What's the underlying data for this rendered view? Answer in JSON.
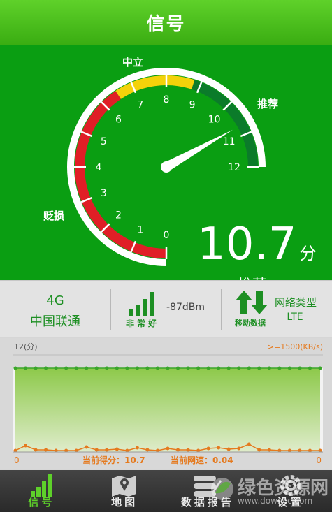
{
  "header": {
    "title": "信号"
  },
  "gauge": {
    "score": "10.7",
    "unit": "分",
    "level": "推荐",
    "zone_labels": {
      "neutral": "中立",
      "recommend": "推荐",
      "poor": "贬损"
    },
    "ticks": [
      "0",
      "1",
      "2",
      "3",
      "4",
      "5",
      "6",
      "7",
      "8",
      "9",
      "10",
      "11",
      "12"
    ],
    "min": 0,
    "max": 12,
    "value": 10.7,
    "colors": {
      "red": "#e01e26",
      "yellow": "#f4d20a",
      "green": "#0b7b2a"
    }
  },
  "network": {
    "generation": "4G",
    "carrier": "中国联通"
  },
  "signal": {
    "quality": "非常好",
    "dbm": "-87dBm",
    "level": 4
  },
  "data_conn": {
    "label": "移动数据"
  },
  "net_type": {
    "label": "网络类型",
    "value": "LTE"
  },
  "chart_data": {
    "type": "line",
    "left_axis_label": "12(分)",
    "right_axis_label": ">=1500(KB/s)",
    "x_left_label": "0",
    "x_right_label": "0",
    "score_text": "当前得分：10.7",
    "speed_text": "当前网速：0.04",
    "series": [
      {
        "name": "当前得分",
        "color": "#3aa62a",
        "values": [
          12,
          12,
          12,
          12,
          12,
          12,
          12,
          12,
          12,
          12,
          12,
          12,
          12,
          12,
          12,
          12,
          12,
          12,
          12,
          12,
          12,
          12,
          12,
          12,
          12,
          12,
          12,
          12,
          12,
          12,
          12
        ]
      },
      {
        "name": "当前网速",
        "color": "#e57a1e",
        "values": [
          0.2,
          0.9,
          0.3,
          0.3,
          0.2,
          0.2,
          0.2,
          0.7,
          0.3,
          0.3,
          0.4,
          0.2,
          0.6,
          0.3,
          0.2,
          0.5,
          0.3,
          0.3,
          0.2,
          0.5,
          0.6,
          0.4,
          0.5,
          1.1,
          0.3,
          0.3,
          0.2,
          0.2,
          0.2,
          0.2,
          0.2
        ]
      }
    ],
    "ylim": [
      0,
      12
    ]
  },
  "tabs": [
    {
      "label": "信号",
      "icon": "signal-bars-icon",
      "active": true
    },
    {
      "label": "地图",
      "icon": "map-icon",
      "active": false
    },
    {
      "label": "数据报告",
      "icon": "report-icon",
      "active": false
    },
    {
      "label": "设置",
      "icon": "gear-icon",
      "active": false
    }
  ],
  "watermark": {
    "text": "绿色资源网",
    "url": "www.downcc.com"
  }
}
